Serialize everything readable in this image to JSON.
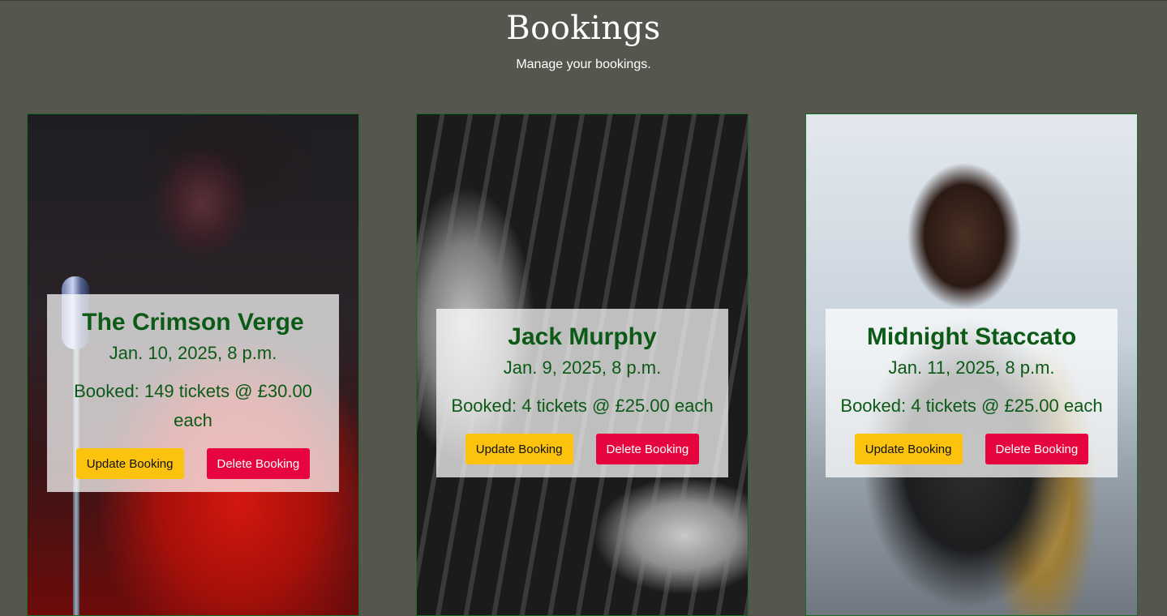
{
  "header": {
    "title": "Bookings",
    "subtitle": "Manage your bookings."
  },
  "bookings": [
    {
      "event_name": "The Crimson Verge",
      "date": "Jan. 10, 2025, 8 p.m.",
      "booked_text": "Booked: 149 tickets @ £30.00 each",
      "update_label": "Update Booking",
      "delete_label": "Delete Booking"
    },
    {
      "event_name": "Jack Murphy",
      "date": "Jan. 9, 2025, 8 p.m.",
      "booked_text": "Booked: 4 tickets @ £25.00 each",
      "update_label": "Update Booking",
      "delete_label": "Delete Booking"
    },
    {
      "event_name": "Midnight Staccato",
      "date": "Jan. 11, 2025, 8 p.m.",
      "booked_text": "Booked: 4 tickets @ £25.00 each",
      "update_label": "Update Booking",
      "delete_label": "Delete Booking"
    }
  ],
  "colors": {
    "background": "#56564e",
    "title_text": "#ffffff",
    "card_text": "#0b5a16",
    "card_border": "#1a6b26",
    "update_button": "#fbc30e",
    "delete_button": "#e7053f"
  }
}
